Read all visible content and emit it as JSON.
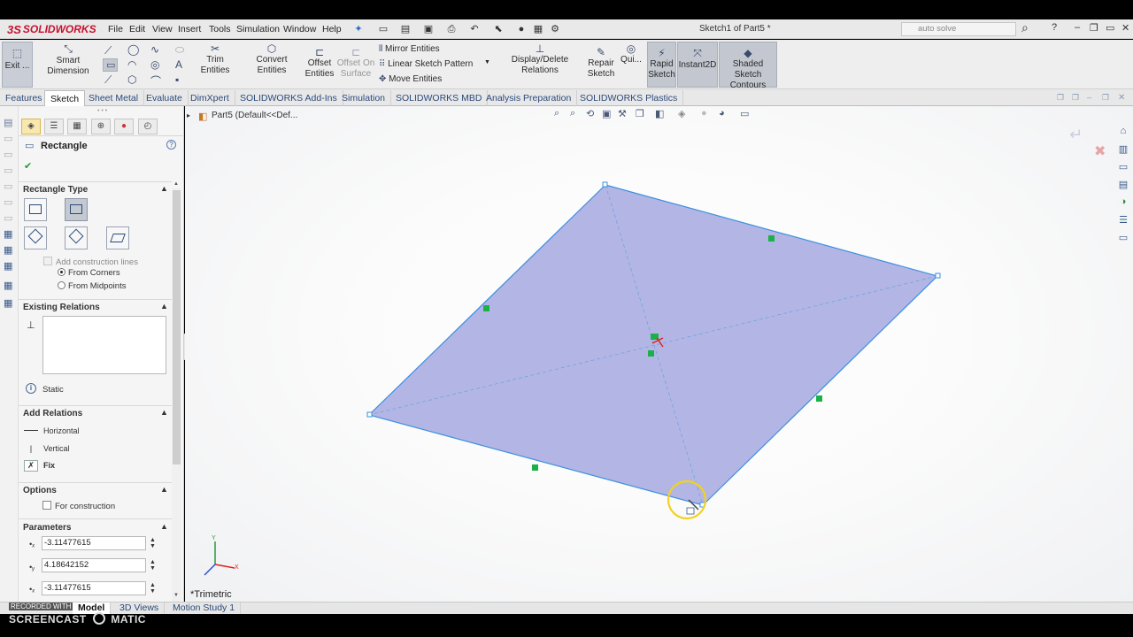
{
  "app": {
    "logo_prefix": "3S",
    "logo_text": "SOLIDWORKS",
    "document_title": "Sketch1 of Part5 *",
    "search_placeholder": "auto solve"
  },
  "menu": {
    "items": [
      "File",
      "Edit",
      "View",
      "Insert",
      "Tools",
      "Simulation",
      "Window",
      "Help"
    ]
  },
  "commands": {
    "exit_label": "Exit ...",
    "smart_dimension": "Smart Dimension",
    "trim_entities": "Trim Entities",
    "convert_entities": "Convert Entities",
    "offset_entities_1": "Offset",
    "offset_entities_2": "Entities",
    "offset_surface_1": "Offset On",
    "offset_surface_2": "Surface",
    "mirror_entities": "Mirror Entities",
    "linear_pattern": "Linear Sketch Pattern",
    "move_entities": "Move Entities",
    "display_delete_relations": "Display/Delete Relations",
    "repair_sketch_1": "Repair",
    "repair_sketch_2": "Sketch",
    "quick_snaps": "Qui...",
    "rapid_sketch_1": "Rapid",
    "rapid_sketch_2": "Sketch",
    "instant2d": "Instant2D",
    "shaded_contours_1": "Shaded Sketch",
    "shaded_contours_2": "Contours"
  },
  "tabs": [
    "Features",
    "Sketch",
    "Sheet Metal",
    "Evaluate",
    "DimXpert",
    "SOLIDWORKS Add-Ins",
    "Simulation",
    "SOLIDWORKS MBD",
    "Analysis Preparation",
    "SOLIDWORKS Plastics"
  ],
  "active_tab": "Sketch",
  "property_manager": {
    "title": "Rectangle",
    "help": "?",
    "ok": "✔",
    "rect_type": {
      "title": "Rectangle Type",
      "add_construction": "Add construction lines",
      "from_corners": "From Corners",
      "from_midpoints": "From Midpoints"
    },
    "existing_relations": {
      "title": "Existing Relations",
      "status": "Static"
    },
    "add_relations": {
      "title": "Add Relations",
      "horizontal": "Horizontal",
      "vertical": "Vertical",
      "fix": "Fix"
    },
    "options": {
      "title": "Options",
      "for_construction": "For construction"
    },
    "parameters": {
      "title": "Parameters",
      "x1": "-3.11477615",
      "y1": "4.18642152",
      "x2": "-3.11477615"
    }
  },
  "viewport": {
    "breadcrumb": "Part5  (Default<<Def...",
    "view_label": "*Trimetric"
  },
  "bottom_tabs": [
    "Model",
    "3D Views",
    "Motion Study 1"
  ],
  "active_bottom_tab": "Model",
  "watermark": {
    "recorded": "RECORDED WITH",
    "screencast": "SCREENCAST",
    "matic": "MATIC"
  },
  "colors": {
    "sketch_fill": "#a6a9e0",
    "sketch_edge": "#3d8fe0",
    "relation_green": "#1bb14a",
    "cursor_ring": "#f2d21a"
  }
}
